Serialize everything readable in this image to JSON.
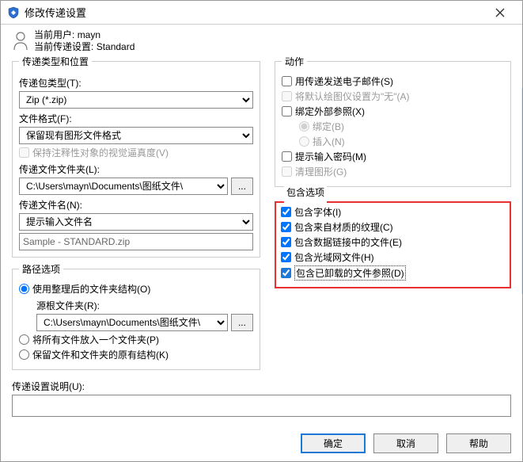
{
  "window": {
    "title": "修改传递设置"
  },
  "user": {
    "current_user_label": "当前用户:",
    "current_user_value": "mayn",
    "current_setting_label": "当前传递设置:",
    "current_setting_value": "Standard"
  },
  "left": {
    "group_title": "传递类型和位置",
    "package_type_label": "传递包类型(T):",
    "package_type_value": "Zip (*.zip)",
    "file_format_label": "文件格式(F):",
    "file_format_value": "保留现有图形文件格式",
    "keep_visual_label": "保持注释性对象的视觉逼真度(V)",
    "folder_label": "传递文件文件夹(L):",
    "folder_value": "C:\\Users\\mayn\\Documents\\图纸文件\\",
    "filename_label": "传递文件名(N):",
    "filename_select": "提示输入文件名",
    "filename_sample": "Sample - STANDARD.zip",
    "path_group_title": "路径选项",
    "path_opt1": "使用整理后的文件夹结构(O)",
    "source_root_label": "源根文件夹(R):",
    "source_root_value": "C:\\Users\\mayn\\Documents\\图纸文件\\",
    "path_opt2": "将所有文件放入一个文件夹(P)",
    "path_opt3": "保留文件和文件夹的原有结构(K)"
  },
  "right": {
    "actions_group": "动作",
    "act_email": "用传递发送电子邮件(S)",
    "act_plotter": "将默认绘图仪设置为\"无\"(A)",
    "act_bindxref": "绑定外部参照(X)",
    "act_bind": "绑定(B)",
    "act_insert": "插入(N)",
    "act_password": "提示输入密码(M)",
    "act_purge": "清理图形(G)",
    "include_group": "包含选项",
    "inc_fonts": "包含字体(I)",
    "inc_textures": "包含来自材质的纹理(C)",
    "inc_datalink": "包含数据链接中的文件(E)",
    "inc_photometric": "包含光域网文件(H)",
    "inc_unloaded": "包含已卸载的文件参照(D)"
  },
  "desc_label": "传递设置说明(U):",
  "buttons": {
    "ok": "确定",
    "cancel": "取消",
    "help": "帮助"
  },
  "browse": "..."
}
